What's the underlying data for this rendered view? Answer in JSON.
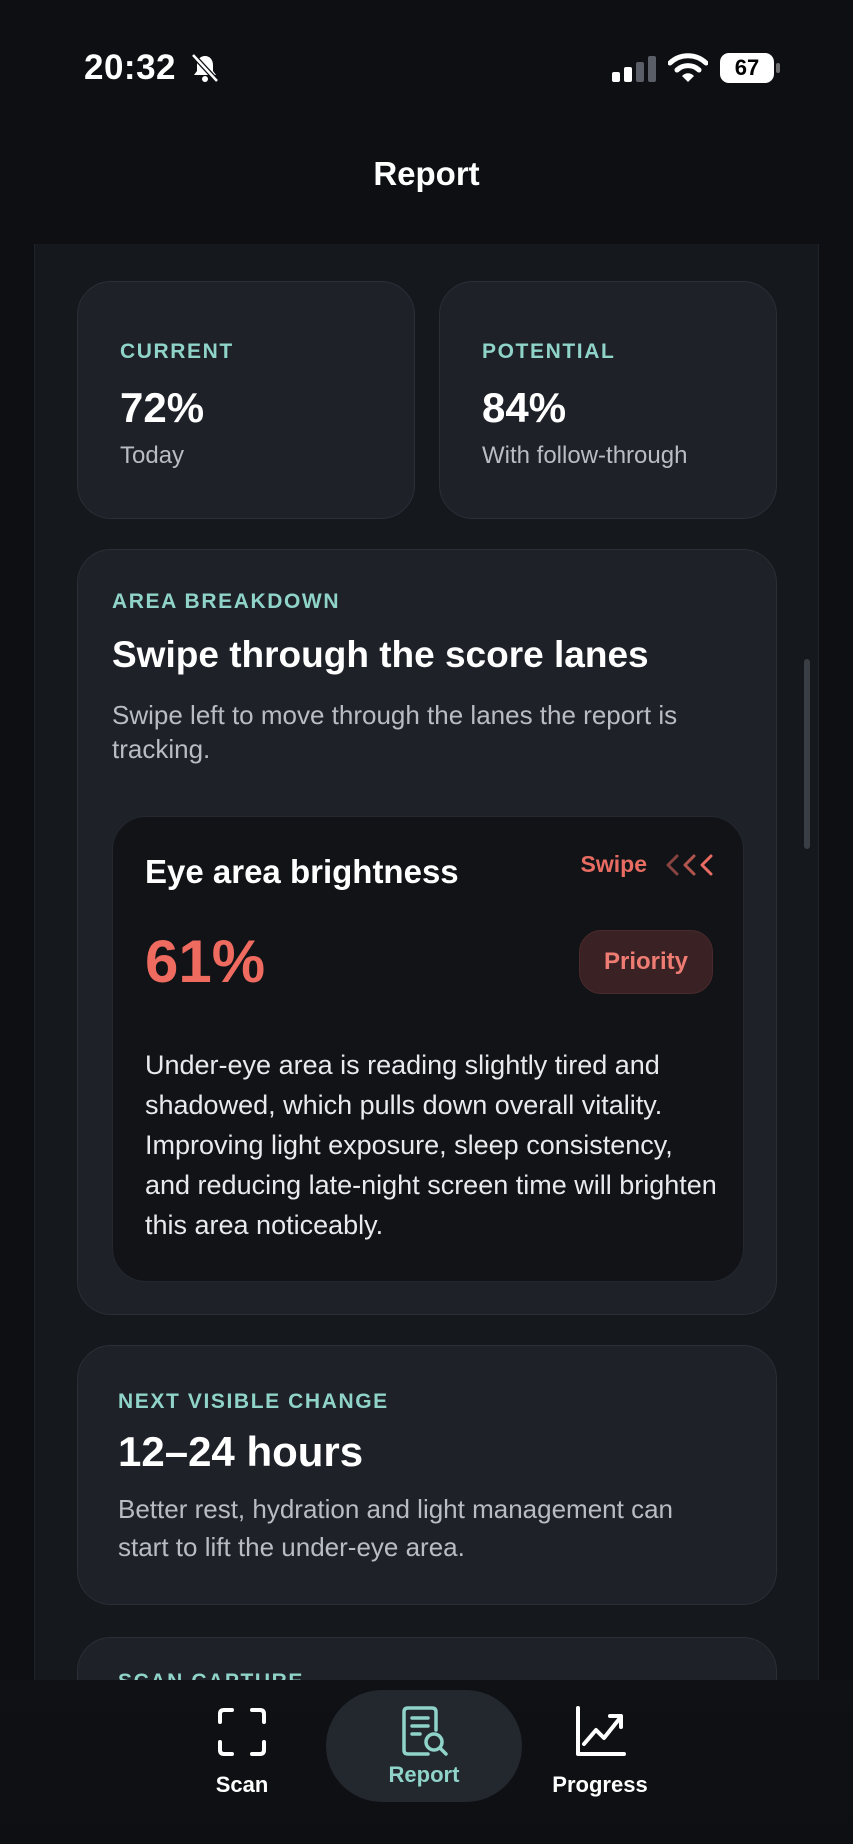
{
  "status_bar": {
    "time": "20:32",
    "battery": "67"
  },
  "nav": {
    "title": "Report"
  },
  "stats": {
    "current": {
      "label": "CURRENT",
      "value": "72%",
      "sub": "Today"
    },
    "potential": {
      "label": "POTENTIAL",
      "value": "84%",
      "sub": "With follow-through"
    }
  },
  "breakdown": {
    "label": "AREA BREAKDOWN",
    "title": "Swipe through the score lanes",
    "description": "Swipe left to move through the lanes the report is tracking.",
    "lane": {
      "title": "Eye area brightness",
      "swipe_label": "Swipe",
      "value": "61%",
      "badge": "Priority",
      "description": "Under-eye area is reading slightly tired and shadowed, which pulls down overall vitality. Improving light exposure, sleep consistency, and reducing late-night screen time will brighten this area noticeably."
    }
  },
  "next_change": {
    "label": "NEXT VISIBLE CHANGE",
    "title": "12–24 hours",
    "description": "Better rest, hydration and light management can start to lift the under-eye area."
  },
  "scan_capture": {
    "label": "SCAN CAPTURE"
  },
  "tabs": [
    {
      "label": "Scan",
      "icon": "scan-frame-icon"
    },
    {
      "label": "Report",
      "icon": "report-search-icon",
      "active": true
    },
    {
      "label": "Progress",
      "icon": "trend-chart-icon"
    }
  ],
  "colors": {
    "accent_teal": "#8fd3c9",
    "priority_red": "#ef6b60",
    "background": "#0d0f12",
    "card": "#1e2228"
  }
}
